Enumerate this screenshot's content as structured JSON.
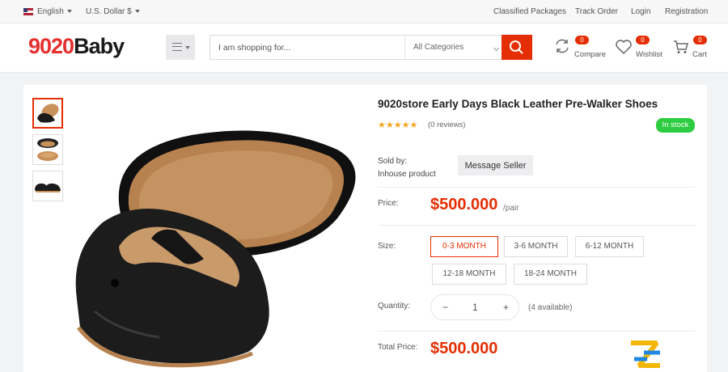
{
  "topbar": {
    "language": "English",
    "currency": "U.S. Dollar $",
    "links": [
      "Classified Packages",
      "Track Order",
      "Login",
      "Registration"
    ]
  },
  "header": {
    "logo_part1": "9020",
    "logo_part2": "Baby",
    "search_placeholder": "I am shopping for...",
    "category_select": "All Categories",
    "compare_label": "Compare",
    "compare_count": "0",
    "wishlist_label": "Wishlist",
    "wishlist_count": "0",
    "cart_label": "Cart",
    "cart_count": "0"
  },
  "product": {
    "title": "9020store Early Days Black Leather Pre-Walker Shoes",
    "rating_stars": 5,
    "reviews": "(0 reviews)",
    "stock_badge": "In stock",
    "sold_by_label": "Sold by:",
    "seller": "Inhouse product",
    "message_button": "Message Seller",
    "price_label": "Price:",
    "price": "$500.000",
    "price_unit": "/pair",
    "size_label": "Size:",
    "sizes": [
      "0-3 MONTH",
      "3-6 MONTH",
      "6-12 MONTH",
      "12-18 MONTH",
      "18-24 MONTH"
    ],
    "selected_size": "0-3 MONTH",
    "quantity_label": "Quantity:",
    "quantity": "1",
    "minus": "−",
    "plus": "+",
    "available": "(4 available)",
    "total_label": "Total Price:",
    "total_price": "$500.000"
  },
  "colors": {
    "accent": "#e62e04",
    "in_stock": "#2ecc40",
    "star": "#f5a623"
  }
}
